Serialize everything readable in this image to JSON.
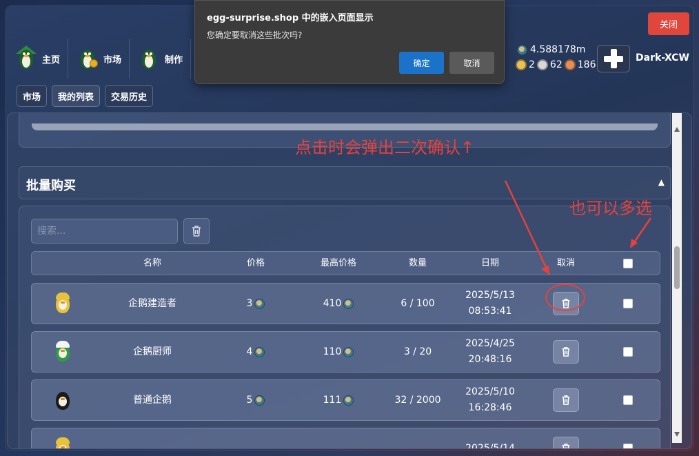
{
  "window": {
    "close_label": "关闭"
  },
  "nav": [
    {
      "label": "主页",
      "icon": "penguin-house-icon"
    },
    {
      "label": "市场",
      "icon": "penguin-coin-icon"
    },
    {
      "label": "制作",
      "icon": "penguin-craft-icon"
    }
  ],
  "stats": {
    "eggs": "4.588178m",
    "gold": "2",
    "silver": "62",
    "bronze": "186"
  },
  "user": {
    "name": "Dark-XCW"
  },
  "subtabs": [
    "市场",
    "我的列表",
    "交易历史"
  ],
  "section": {
    "title": "批量购买",
    "arrow": "▲"
  },
  "search": {
    "placeholder": "搜索..."
  },
  "table": {
    "headers": [
      "名称",
      "价格",
      "最高价格",
      "数量",
      "日期",
      "取消"
    ],
    "rows": [
      {
        "name": "企鹅建造者",
        "price": "3",
        "max_price": "410",
        "qty": "6 / 100",
        "date": "2025/5/13",
        "time": "08:53:41",
        "color": "#e8c23a"
      },
      {
        "name": "企鹅厨师",
        "price": "4",
        "max_price": "110",
        "qty": "3 / 20",
        "date": "2025/4/25",
        "time": "20:48:16",
        "color": "#2e9a4a"
      },
      {
        "name": "普通企鹅",
        "price": "5",
        "max_price": "111",
        "qty": "32 / 2000",
        "date": "2025/5/10",
        "time": "16:28:46",
        "color": "#1a1a1a"
      },
      {
        "name": "",
        "price": "",
        "max_price": "",
        "qty": "",
        "date": "2025/5/14",
        "time": "",
        "color": "#e8c23a"
      }
    ]
  },
  "dialog": {
    "title": "egg-surprise.shop 中的嵌入页面显示",
    "message": "您确定要取消这些批次吗?",
    "ok": "确定",
    "cancel": "取消"
  },
  "annotations": {
    "confirm_note": "点击时会弹出二次确认↑",
    "multi_note": "也可以多选"
  },
  "colors": {
    "accent_red": "#e8413c",
    "dialog_ok": "#1a73c9",
    "close_btn": "#e0463b"
  }
}
